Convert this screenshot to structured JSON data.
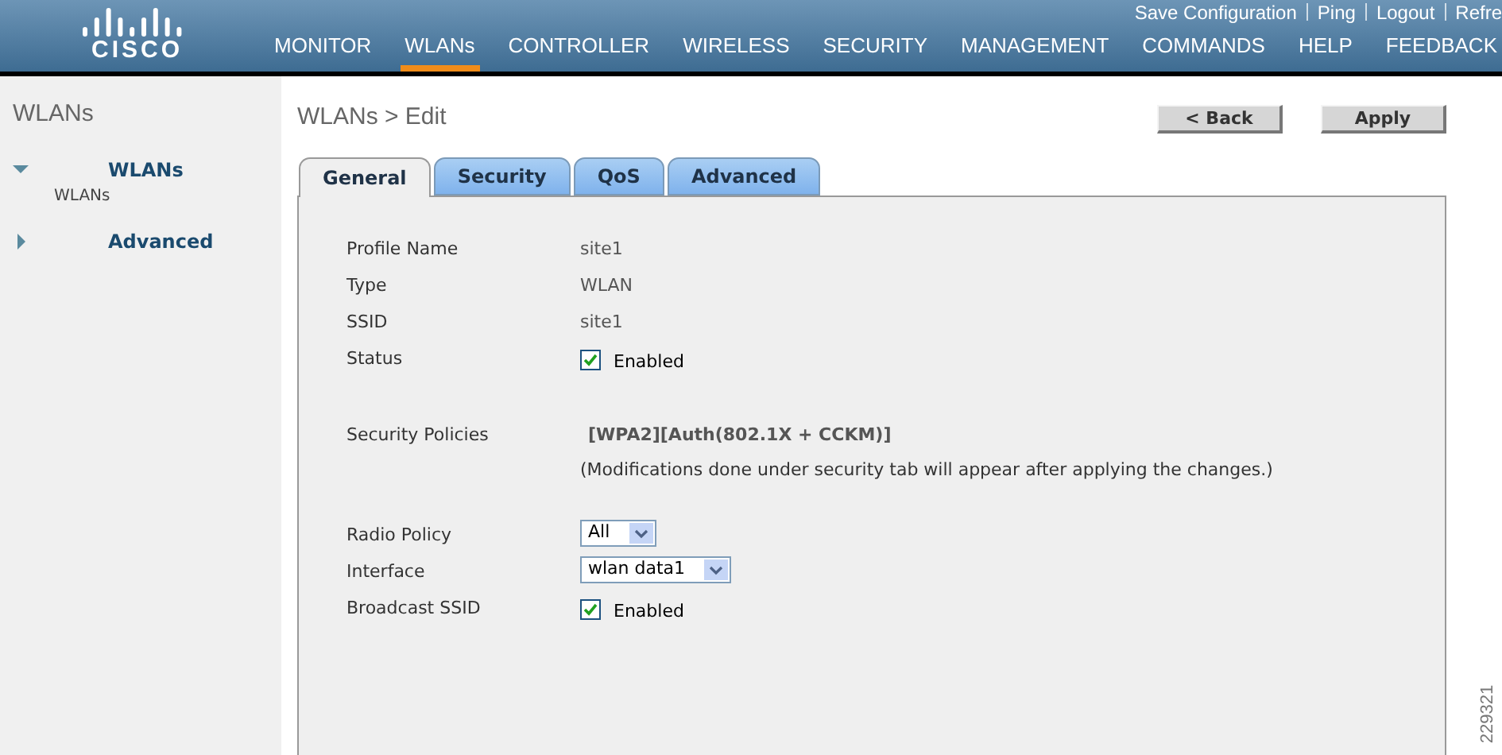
{
  "header": {
    "logo": "CISCO",
    "top_links": [
      "Save Configuration",
      "Ping",
      "Logout",
      "Refre"
    ],
    "nav": [
      {
        "label": "MONITOR",
        "selected": false
      },
      {
        "label": "WLANs",
        "selected": true
      },
      {
        "label": "CONTROLLER",
        "selected": false
      },
      {
        "label": "WIRELESS",
        "selected": false
      },
      {
        "label": "SECURITY",
        "selected": false
      },
      {
        "label": "MANAGEMENT",
        "selected": false
      },
      {
        "label": "COMMANDS",
        "selected": false
      },
      {
        "label": "HELP",
        "selected": false
      },
      {
        "label": "FEEDBACK",
        "selected": false
      }
    ]
  },
  "sidebar": {
    "title": "WLANs",
    "items": [
      {
        "label": "WLANs",
        "expanded": true,
        "children": [
          {
            "label": "WLANs"
          }
        ]
      },
      {
        "label": "Advanced",
        "expanded": false
      }
    ]
  },
  "page": {
    "breadcrumb": "WLANs > Edit",
    "buttons": [
      "< Back",
      "Apply"
    ],
    "tabs": [
      {
        "label": "General",
        "selected": true
      },
      {
        "label": "Security",
        "selected": false
      },
      {
        "label": "QoS",
        "selected": false
      },
      {
        "label": "Advanced",
        "selected": false
      }
    ],
    "groups": [
      [
        {
          "kind": "text",
          "label": "Profile Name",
          "value": "site1"
        },
        {
          "kind": "text",
          "label": "Type",
          "value": "WLAN"
        },
        {
          "kind": "text",
          "label": "SSID",
          "value": "site1"
        },
        {
          "kind": "checkbox",
          "label": "Status",
          "checked": true,
          "text": "Enabled"
        }
      ],
      [
        {
          "kind": "policy",
          "label": "Security Policies",
          "value": "[WPA2][Auth(802.1X + CCKM)]",
          "note": "(Modifications done under security tab will appear after applying the changes.)"
        }
      ],
      [
        {
          "kind": "select",
          "label": "Radio Policy",
          "value": "All"
        },
        {
          "kind": "select",
          "label": "Interface",
          "value": "wlan data1"
        },
        {
          "kind": "checkbox",
          "label": "Broadcast SSID",
          "checked": true,
          "text": "Enabled"
        }
      ]
    ]
  },
  "figure_id": "229321"
}
